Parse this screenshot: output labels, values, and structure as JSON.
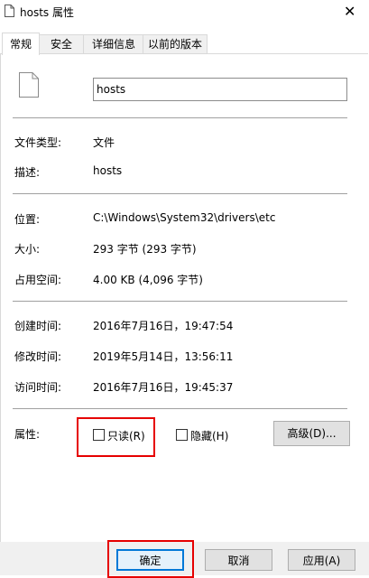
{
  "window": {
    "title": "hosts 属性",
    "close_glyph": "✕"
  },
  "tabs": [
    {
      "label": "常规",
      "active": true
    },
    {
      "label": "安全",
      "active": false
    },
    {
      "label": "详细信息",
      "active": false
    },
    {
      "label": "以前的版本",
      "active": false
    }
  ],
  "file": {
    "name": "hosts"
  },
  "info": {
    "type_label": "文件类型:",
    "type_value": "文件",
    "desc_label": "描述:",
    "desc_value": "hosts",
    "location_label": "位置:",
    "location_value": "C:\\Windows\\System32\\drivers\\etc",
    "size_label": "大小:",
    "size_value": "293 字节 (293 字节)",
    "disk_label": "占用空间:",
    "disk_value": "4.00 KB (4,096 字节)",
    "created_label": "创建时间:",
    "created_value": "2016年7月16日，19:47:54",
    "modified_label": "修改时间:",
    "modified_value": "2019年5月14日，13:56:11",
    "accessed_label": "访问时间:",
    "accessed_value": "2016年7月16日，19:45:37"
  },
  "attributes": {
    "label": "属性:",
    "readonly_label": "只读(R)",
    "readonly_checked": false,
    "hidden_label": "隐藏(H)",
    "hidden_checked": false,
    "advanced_label": "高级(D)..."
  },
  "buttons": {
    "ok": "确定",
    "cancel": "取消",
    "apply": "应用(A)"
  },
  "highlight_color": "#e60000"
}
